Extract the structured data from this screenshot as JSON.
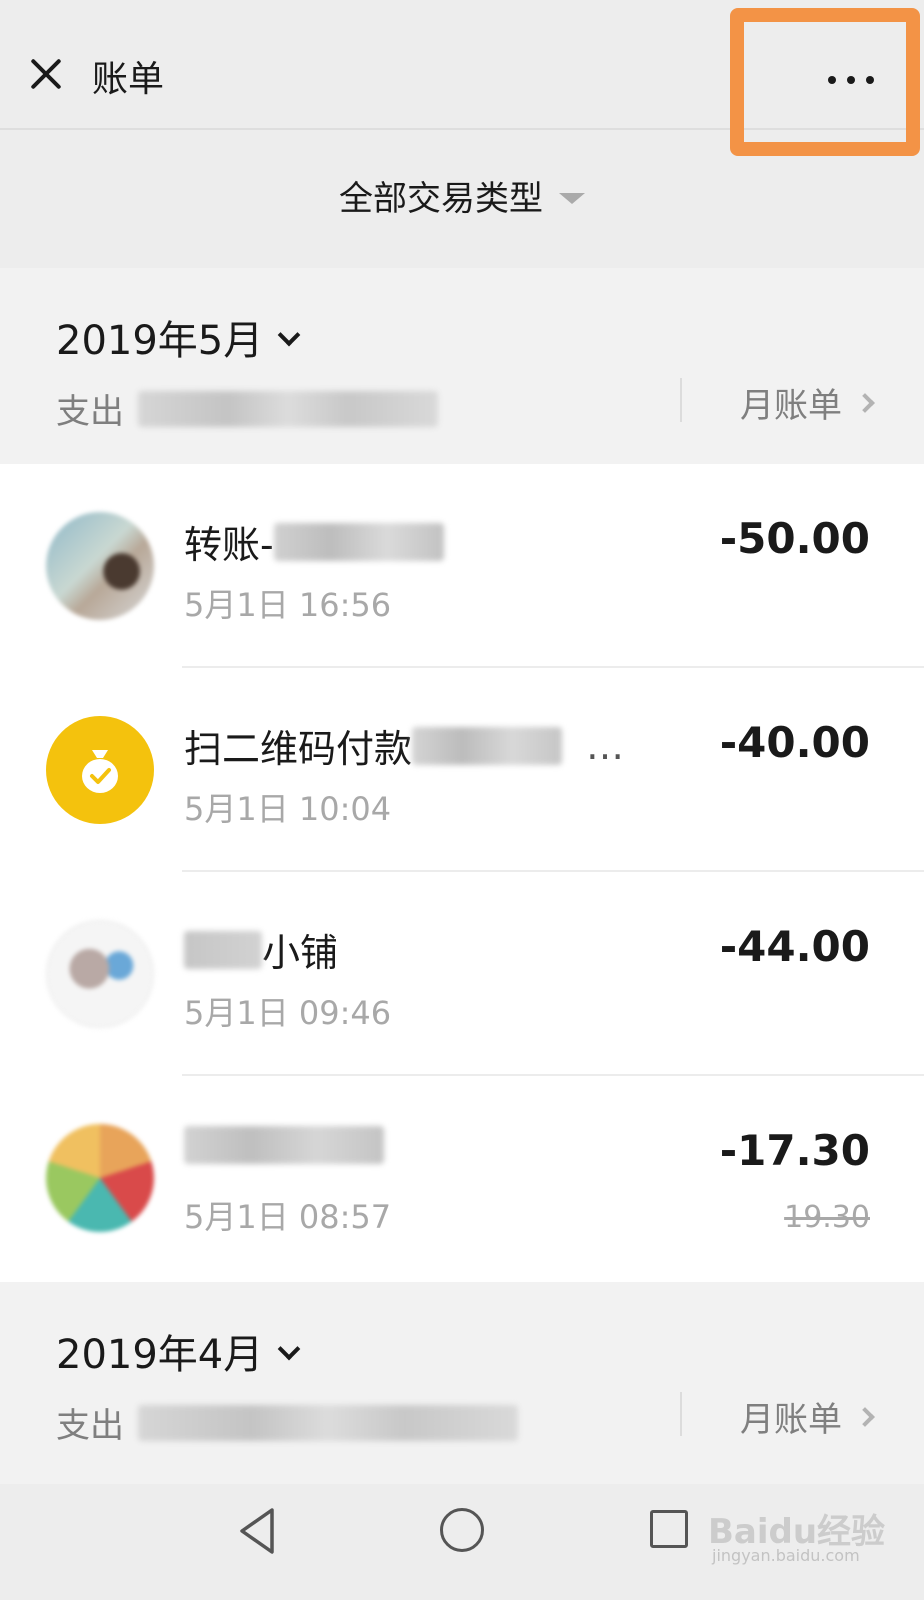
{
  "header": {
    "title": "账单"
  },
  "filter": {
    "label": "全部交易类型"
  },
  "months": [
    {
      "title": "2019年5月",
      "expense_label": "支出",
      "bill_link": "月账单"
    },
    {
      "title": "2019年4月",
      "expense_label": "支出",
      "bill_link": "月账单"
    }
  ],
  "transactions": [
    {
      "name": "转账-",
      "time": "5月1日 16:56",
      "amount": "-50.00"
    },
    {
      "name": "扫二维码付款",
      "name_suffix": "…",
      "time": "5月1日 10:04",
      "amount": "-40.00"
    },
    {
      "name": "小铺",
      "time": "5月1日 09:46",
      "amount": "-44.00"
    },
    {
      "name": "",
      "time": "5月1日 08:57",
      "amount": "-17.30",
      "original_amount": "19.30"
    }
  ],
  "watermark": {
    "brand": "Baidu经验",
    "url": "jingyan.baidu.com"
  },
  "colors": {
    "highlight": "#f39346",
    "pay_icon": "#f4c20d"
  }
}
